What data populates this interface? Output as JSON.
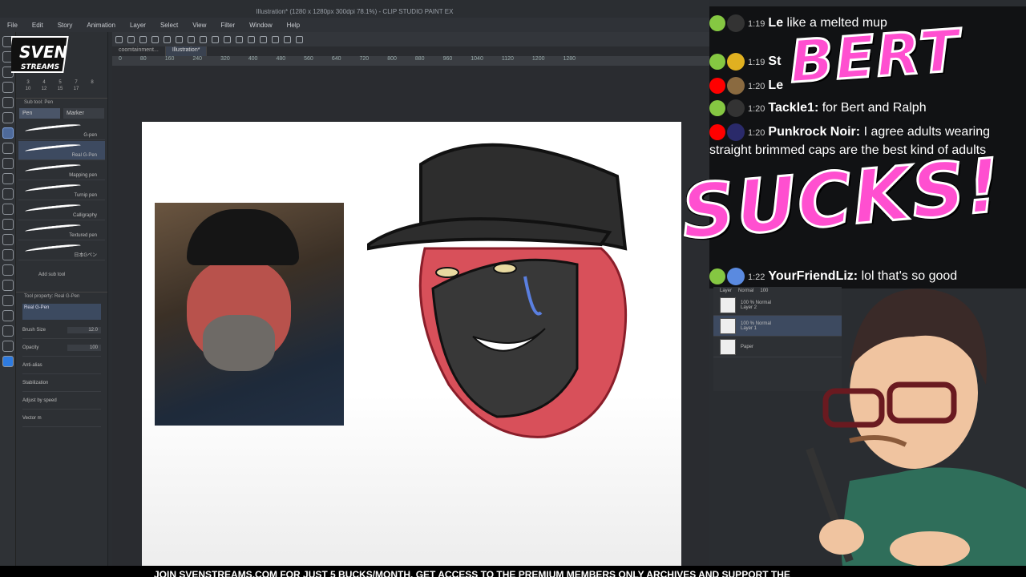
{
  "app": {
    "title": "Illustration* (1280 x 1280px 300dpi 78.1%) - CLIP STUDIO PAINT EX",
    "menu": [
      "File",
      "Edit",
      "Story",
      "Animation",
      "Layer",
      "Select",
      "View",
      "Filter",
      "Window",
      "Help"
    ],
    "tabs": [
      "coomtainment...",
      "Illustration*"
    ],
    "ruler_ticks": [
      "0",
      "80",
      "160",
      "240",
      "320",
      "400",
      "480",
      "560",
      "640",
      "720",
      "800",
      "880",
      "960",
      "1040",
      "1120",
      "1200",
      "1280"
    ]
  },
  "brush_panel": {
    "sizes": [
      "3",
      "4",
      "5",
      "7",
      "8",
      "10",
      "12",
      "15",
      "17"
    ],
    "subtool_title": "Sub tool: Pen",
    "subtabs": [
      "Pen",
      "Marker"
    ],
    "brushes": [
      "G-pen",
      "Real G-Pen",
      "Mapping pen",
      "Turnip pen",
      "Calligraphy",
      "Textured pen",
      "日本Gペン"
    ],
    "add_sub_tool": "Add sub tool",
    "tool_property_title": "Tool property: Real G-Pen",
    "preview_label": "Real G-Pen",
    "brush_size_label": "Brush Size",
    "brush_size_value": "12.0",
    "opacity_label": "Opacity",
    "opacity_value": "100",
    "antialias_label": "Anti-alias",
    "stabilization_label": "Stabilization",
    "adjust_speed_label": "Adjust by speed",
    "vector_label": "Vector m"
  },
  "layers_panel": {
    "title": "Layer",
    "blend": "Normal",
    "opacity": "100",
    "layers": [
      {
        "mode": "100 % Normal",
        "name": "Layer 2"
      },
      {
        "mode": "100 % Normal",
        "name": "Layer 1"
      },
      {
        "mode": "",
        "name": "Paper"
      }
    ]
  },
  "chat": [
    {
      "time": "1:19",
      "user": "Le",
      "text": "like a melted mup",
      "platform": "rumble"
    },
    {
      "time": "1:19",
      "user": "St",
      "text": "",
      "platform": "rumble"
    },
    {
      "time": "1:20",
      "user": "Le",
      "text": "",
      "platform": "youtube"
    },
    {
      "time": "1:20",
      "user": "Tackle1:",
      "text": "for Bert and Ralph",
      "platform": "rumble"
    },
    {
      "time": "1:20",
      "user": "Punkrock Noir:",
      "text": "I agree adults wearing straight brimmed caps are the best kind of adults",
      "platform": "youtube"
    },
    {
      "time": "1:22",
      "user": "YourFriendLiz:",
      "text": "lol that's so good",
      "platform": "rumble"
    }
  ],
  "overlay": {
    "line1": "BERT",
    "line2": "SUCKS!",
    "logo_line1": "SVEN",
    "logo_line2": "STREAMS",
    "ticker": "JOIN SVENSTREAMS.COM FOR JUST 5 BUCKS/MONTH. GET ACCESS TO THE PREMIUM MEMBERS ONLY ARCHIVES AND SUPPORT THE"
  },
  "colors": {
    "accent": "#ff4fd0",
    "rumble": "#85c742",
    "youtube": "#ff0000",
    "caricature_skin": "#d8505a",
    "cap": "#2d2d2d"
  }
}
